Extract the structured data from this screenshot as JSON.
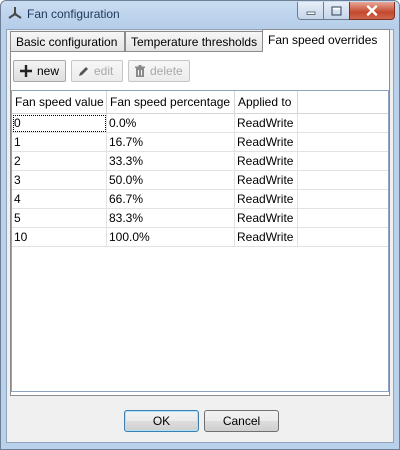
{
  "window": {
    "title": "Fan configuration",
    "icon": "fan-icon"
  },
  "tabs": [
    {
      "label": "Basic configuration",
      "active": false
    },
    {
      "label": "Temperature thresholds",
      "active": false
    },
    {
      "label": "Fan speed overrides",
      "active": true
    }
  ],
  "toolbar": {
    "new_label": "new",
    "edit_label": "edit",
    "delete_label": "delete"
  },
  "grid": {
    "columns": [
      "Fan speed value",
      "Fan speed percentage",
      "Applied to",
      ""
    ],
    "rows": [
      [
        "0",
        "0.0%",
        "ReadWrite"
      ],
      [
        "1",
        "16.7%",
        "ReadWrite"
      ],
      [
        "2",
        "33.3%",
        "ReadWrite"
      ],
      [
        "3",
        "50.0%",
        "ReadWrite"
      ],
      [
        "4",
        "66.7%",
        "ReadWrite"
      ],
      [
        "5",
        "83.3%",
        "ReadWrite"
      ],
      [
        "10",
        "100.0%",
        "ReadWrite"
      ]
    ]
  },
  "buttons": {
    "ok": "OK",
    "cancel": "Cancel"
  }
}
